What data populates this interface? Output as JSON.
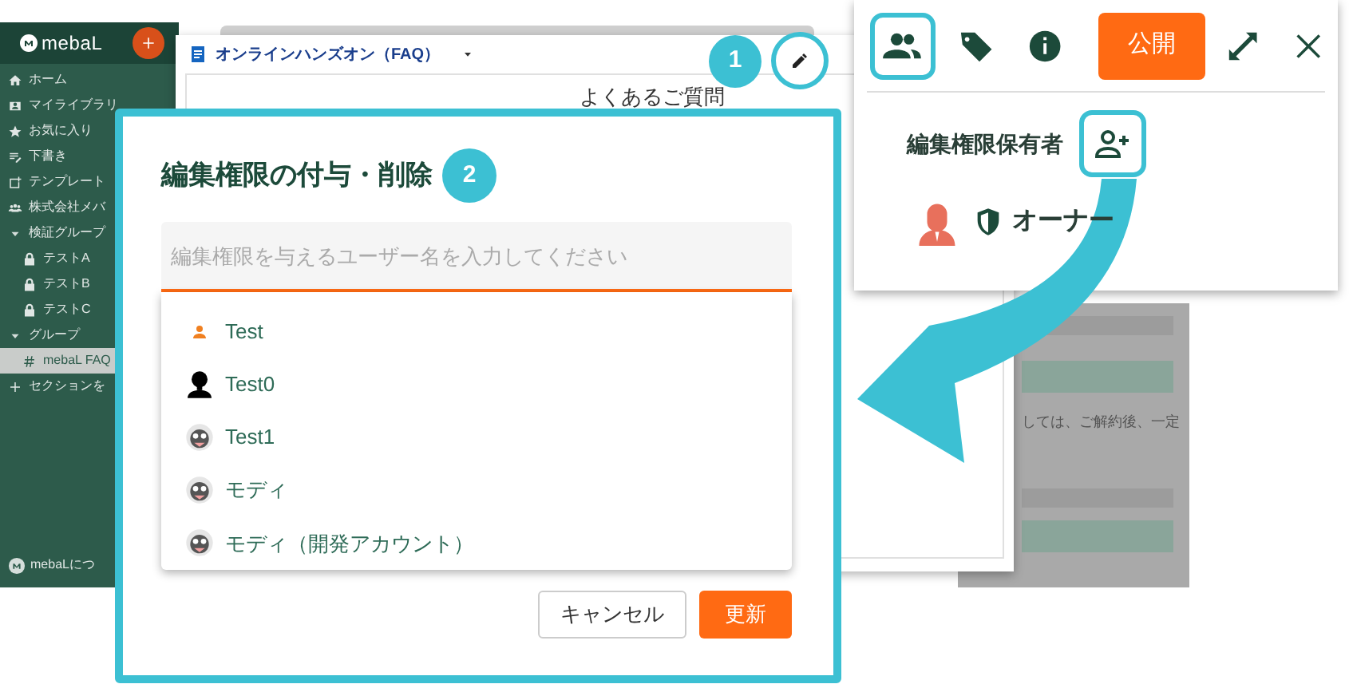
{
  "app": {
    "logo": "mebaL",
    "sidebar": {
      "items": [
        {
          "label": "ホーム",
          "kind": "home",
          "selected": false
        },
        {
          "label": "マイライブラリ",
          "kind": "library",
          "selected": false
        },
        {
          "label": "お気に入り",
          "kind": "star",
          "selected": false
        },
        {
          "label": "下書き",
          "kind": "draft",
          "selected": false
        },
        {
          "label": "テンプレート",
          "kind": "template",
          "selected": false
        },
        {
          "label": "株式会社メバ",
          "kind": "team",
          "selected": false
        },
        {
          "label": "検証グループ",
          "kind": "group",
          "expanded": true,
          "selected": false,
          "children": [
            {
              "label": "テストA",
              "kind": "lock",
              "selected": false
            },
            {
              "label": "テストB",
              "kind": "lock",
              "selected": false
            },
            {
              "label": "テストC",
              "kind": "lock",
              "selected": false
            }
          ]
        },
        {
          "label": "グループ",
          "kind": "group",
          "expanded": true,
          "selected": false,
          "children": [
            {
              "label": "mebaL FAQ",
              "kind": "channel",
              "selected": true
            }
          ]
        },
        {
          "label": "セクションを",
          "kind": "add",
          "selected": false
        }
      ]
    },
    "footer": "mebaLにつ"
  },
  "document": {
    "title": "オンラインハンズオン（FAQ）",
    "heading": "よくあるご質問",
    "background_text": "しては、ご解約後、一定"
  },
  "steps": [
    {
      "number": "1"
    },
    {
      "number": "2"
    }
  ],
  "share_panel": {
    "publish_button": "公開",
    "section_title": "編集権限保有者",
    "owner": {
      "role": "オーナー"
    }
  },
  "dialog": {
    "title": "編集権限の付与・削除",
    "search": {
      "placeholder": "編集権限を与えるユーザー名を入力してください"
    },
    "suggestions": [
      {
        "name": "Test",
        "kind": "person-icon"
      },
      {
        "name": "Test0",
        "kind": "silhouette"
      },
      {
        "name": "Test1",
        "kind": "image"
      },
      {
        "name": "モディ",
        "kind": "image"
      },
      {
        "name": "モディ（開発アカウント）",
        "kind": "image"
      }
    ],
    "buttons": [
      {
        "label": "キャンセル",
        "kind": "outline"
      },
      {
        "label": "更新",
        "kind": "primary"
      }
    ]
  }
}
